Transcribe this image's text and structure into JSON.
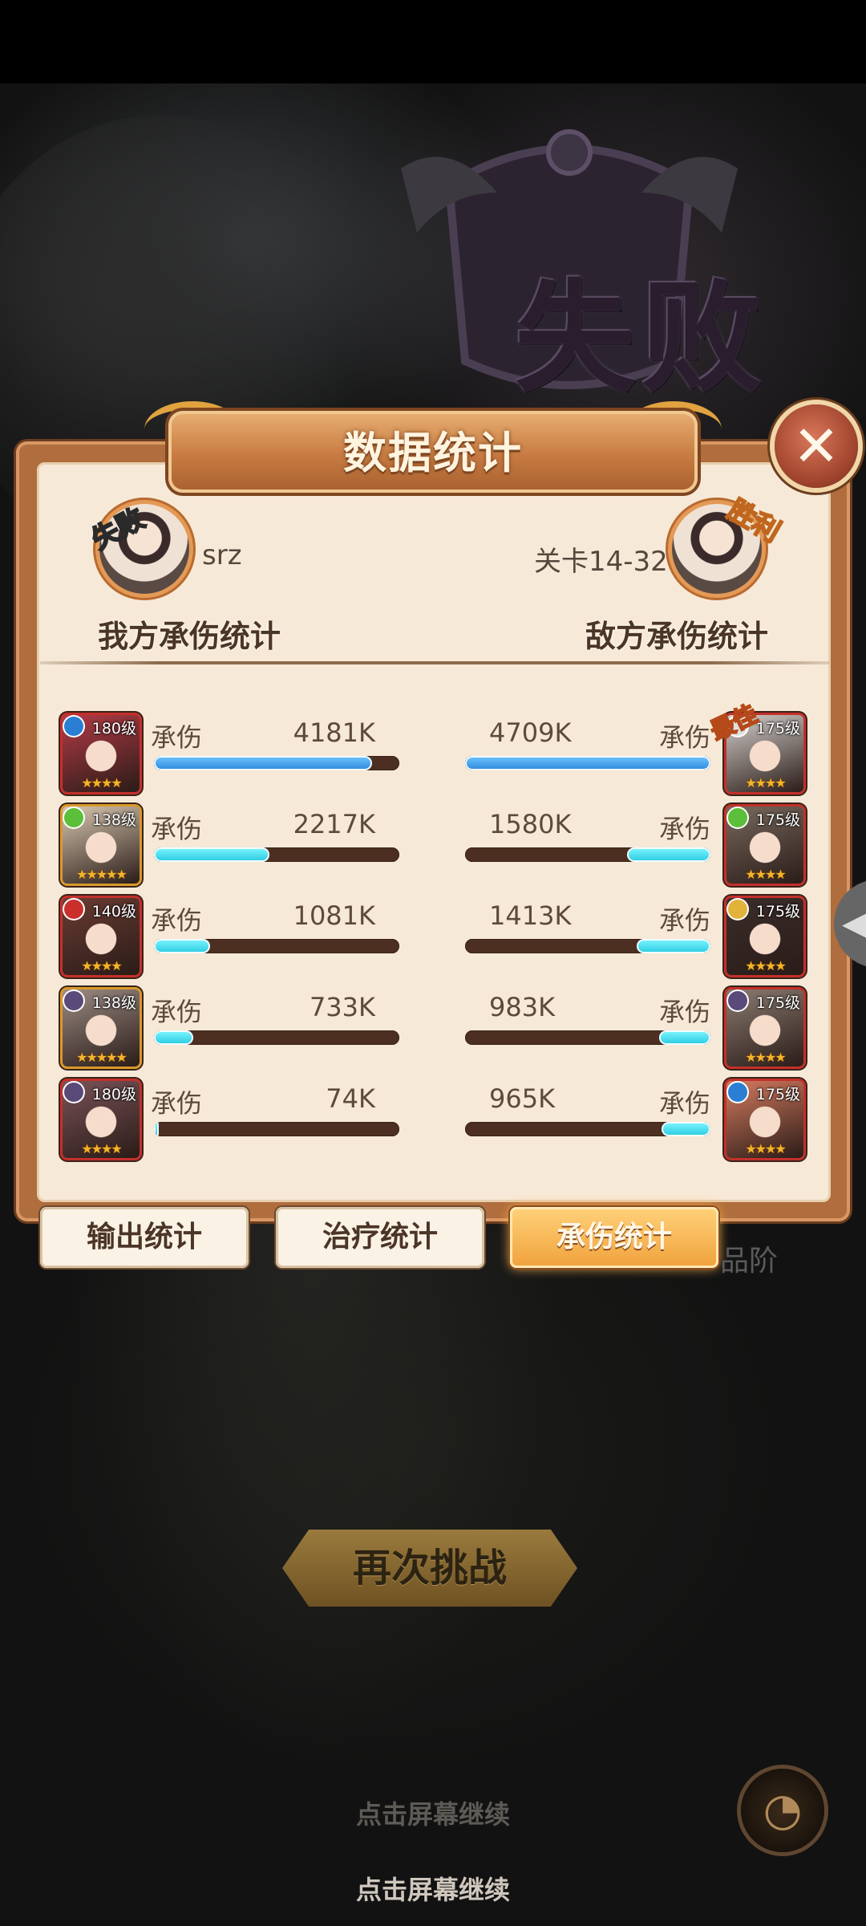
{
  "result_title": "失败",
  "panel": {
    "title": "数据统计",
    "close_icon": "close-icon"
  },
  "player": {
    "name": "srz",
    "badge": "失败",
    "section_title": "我方承伤统计"
  },
  "enemy": {
    "name": "关卡14-32",
    "badge": "胜利",
    "section_title": "敌方承伤统计"
  },
  "stat_label": "承伤",
  "best_label": "最佳",
  "ally_rows": [
    {
      "level": "180级",
      "stars": "★★★★",
      "value": "4181K",
      "ratio": 0.89,
      "bar_color": "blue",
      "frame": "#c3302b",
      "bg": "#b33a46"
    },
    {
      "level": "138级",
      "stars": "★★★★★",
      "value": "2217K",
      "ratio": 0.47,
      "bar_color": "cyan",
      "frame": "#d99a2b",
      "bg": "#d8c7b0"
    },
    {
      "level": "140级",
      "stars": "★★★★",
      "value": "1081K",
      "ratio": 0.23,
      "bar_color": "cyan",
      "frame": "#c3302b",
      "bg": "#6a3b33"
    },
    {
      "level": "138级",
      "stars": "★★★★★",
      "value": "733K",
      "ratio": 0.16,
      "bar_color": "cyan",
      "frame": "#d99a2b",
      "bg": "#9c8b84"
    },
    {
      "level": "180级",
      "stars": "★★★★",
      "value": "74K",
      "ratio": 0.02,
      "bar_color": "cyan",
      "frame": "#c3302b",
      "bg": "#7a5257"
    }
  ],
  "enemy_rows": [
    {
      "level": "175级",
      "stars": "★★★★",
      "value": "4709K",
      "ratio": 1.0,
      "bar_color": "blue",
      "frame": "#c3302b",
      "bg": "#d5cfcc"
    },
    {
      "level": "175级",
      "stars": "★★★★",
      "value": "1580K",
      "ratio": 0.34,
      "bar_color": "cyan",
      "frame": "#c3302b",
      "bg": "#77695c"
    },
    {
      "level": "175级",
      "stars": "★★★★",
      "value": "1413K",
      "ratio": 0.3,
      "bar_color": "cyan",
      "frame": "#c3302b",
      "bg": "#3a2d2a"
    },
    {
      "level": "175级",
      "stars": "★★★★",
      "value": "983K",
      "ratio": 0.21,
      "bar_color": "cyan",
      "frame": "#c3302b",
      "bg": "#8a7b70"
    },
    {
      "level": "175级",
      "stars": "★★★★",
      "value": "965K",
      "ratio": 0.2,
      "bar_color": "cyan",
      "frame": "#c3302b",
      "bg": "#d47a5e"
    }
  ],
  "tabs": [
    {
      "label": "输出统计",
      "active": false
    },
    {
      "label": "治疗统计",
      "active": false
    },
    {
      "label": "承伤统计",
      "active": true
    }
  ],
  "quality_label": "品阶",
  "retry_button": "再次挑战",
  "continue_hint_1": "点击屏幕继续",
  "continue_hint_2": "点击屏幕继续",
  "stats_icon": "pie-chart-icon"
}
